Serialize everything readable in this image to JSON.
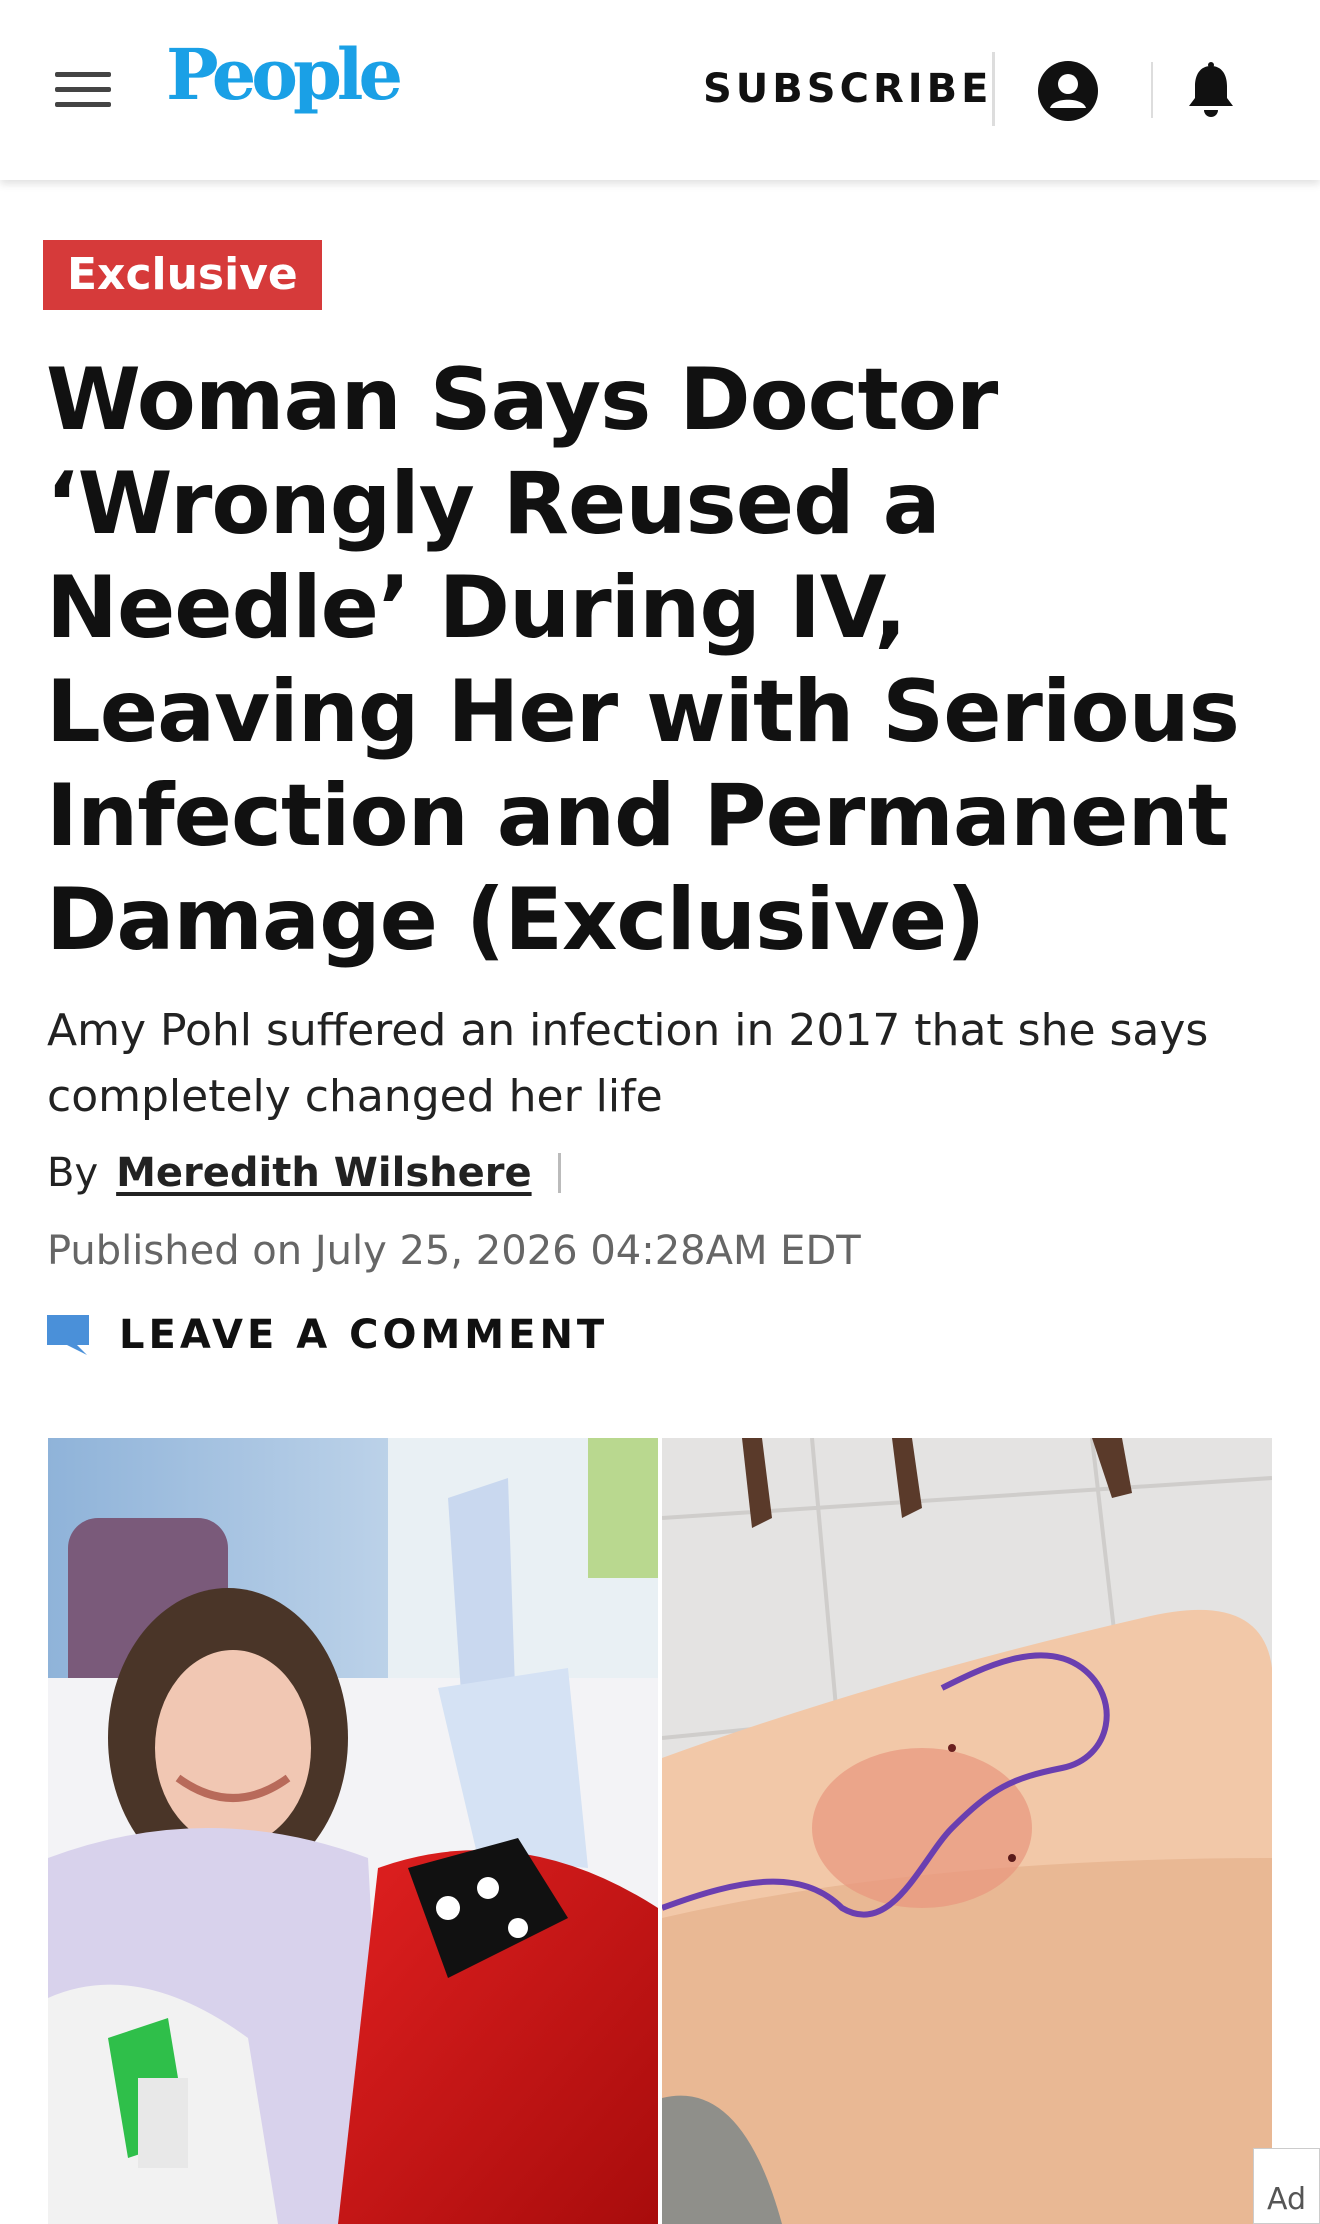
{
  "header": {
    "logo": "People",
    "subscribe_label": "SUBSCRIBE",
    "brand_color": "#1aa0e6"
  },
  "article": {
    "badge": "Exclusive",
    "badge_color": "#d63a3a",
    "headline": "Woman Says Doctor ‘Wrongly Reused a Needle’ During IV, Leaving Her with Serious Infection and Permanent Damage (Exclusive)",
    "subhead": "Amy Pohl suffered an infection in 2017 that she says completely changed her life",
    "byline_prefix": "By",
    "author": "Meredith Wilshere",
    "published": "Published on July 25, 2026 04:28AM EDT",
    "comment_label": "LEAVE A COMMENT",
    "comment_icon": "speech-bubble-icon",
    "comment_icon_color": "#4a90d9"
  },
  "ad": {
    "label": "Ad"
  }
}
